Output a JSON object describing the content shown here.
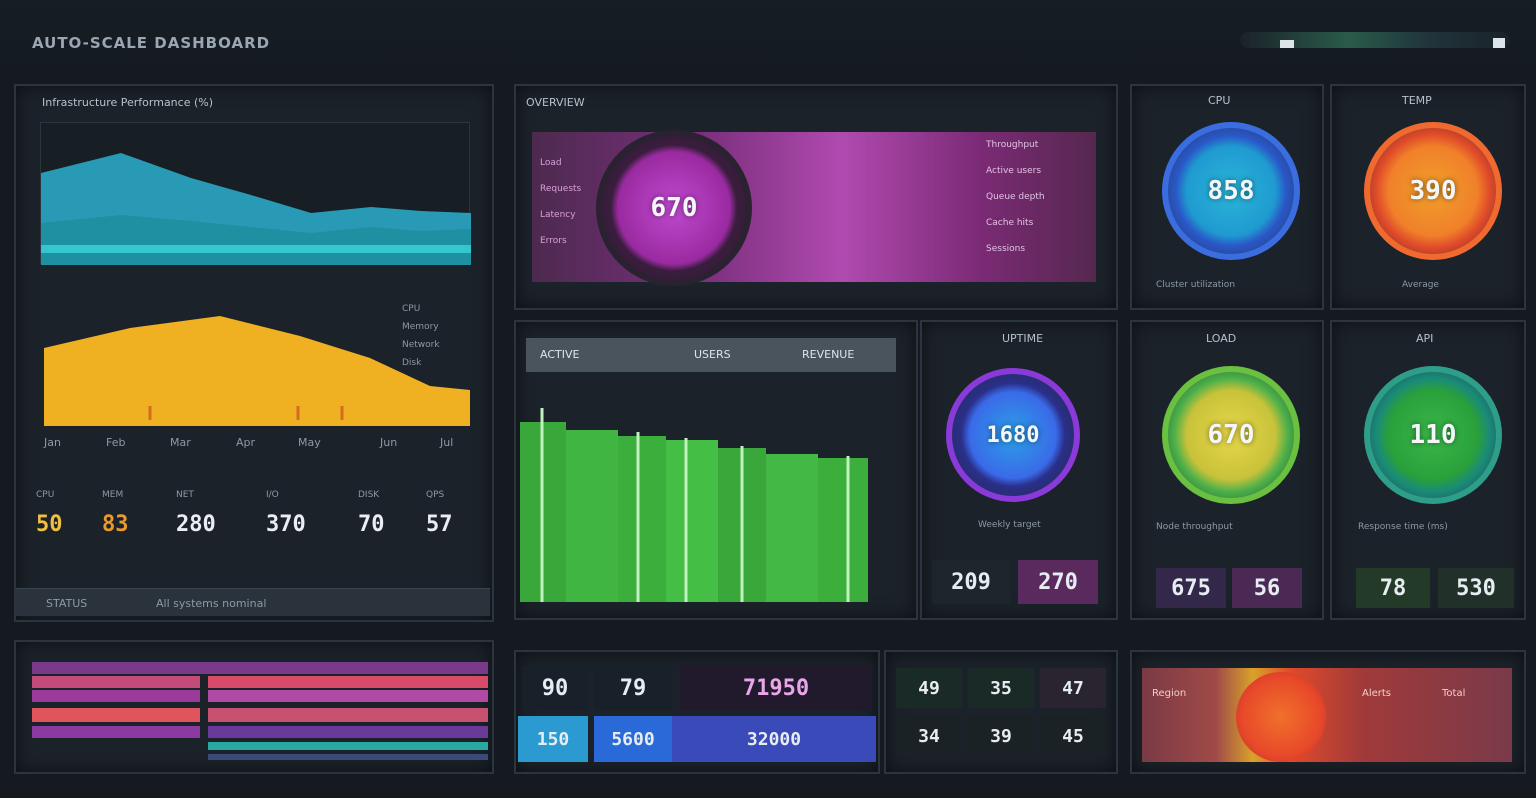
{
  "header": {
    "title": "AUTO-SCALE DASHBOARD"
  },
  "left_panel": {
    "area_chart_title": "Infrastructure Performance (%)",
    "x_ticks": [
      "Jan",
      "Feb",
      "Mar",
      "Apr",
      "May",
      "Jun",
      "Jul"
    ],
    "stats": [
      {
        "label": "CPU",
        "value": "50"
      },
      {
        "label": "MEM",
        "value": "83"
      },
      {
        "label": "NET",
        "value": "280"
      },
      {
        "label": "I/O",
        "value": "370"
      },
      {
        "label": "DISK",
        "value": "70"
      },
      {
        "label": "QPS",
        "value": "57"
      }
    ],
    "footer": {
      "left": "STATUS",
      "right": "All systems nominal"
    },
    "legend": [
      "CPU",
      "Memory",
      "Network",
      "Disk"
    ]
  },
  "center_top": {
    "title": "OVERVIEW",
    "gauge_value": "670",
    "rows": [
      "Load",
      "Requests",
      "Latency",
      "Errors"
    ],
    "side": [
      "Throughput",
      "Active users",
      "Queue depth",
      "Cache hits",
      "Sessions"
    ]
  },
  "center_mid": {
    "headers": [
      "ACTIVE",
      "USERS",
      "REVENUE"
    ],
    "gauge_title": "UPTIME",
    "gauge_value": "1680",
    "caption": "Weekly target",
    "tiles": [
      "209",
      "270"
    ]
  },
  "right_grid": [
    {
      "title": "CPU",
      "value": "858",
      "caption": "Cluster utilization"
    },
    {
      "title": "TEMP",
      "value": "390",
      "caption": "Average"
    },
    {
      "title": "LOAD",
      "value": "670",
      "caption": "Node throughput",
      "tiles": [
        "675",
        "56"
      ]
    },
    {
      "title": "API",
      "value": "110",
      "caption": "Response time (ms)",
      "tiles": [
        "78",
        "530"
      ]
    }
  ],
  "bottom": {
    "center_tiles": [
      "90",
      "79",
      "71950",
      "150",
      "5600",
      "32000"
    ],
    "mid_tiles": [
      "49",
      "35",
      "47",
      "34",
      "39",
      "45"
    ],
    "right_labels": [
      "Region",
      "Alerts",
      "Total"
    ]
  },
  "colors": {
    "bg": "#141a20",
    "panel": "#1b2229",
    "teal": "#2fb8c8",
    "amber": "#f0b52a",
    "magenta": "#b03ab0",
    "green": "#3ec43e"
  }
}
